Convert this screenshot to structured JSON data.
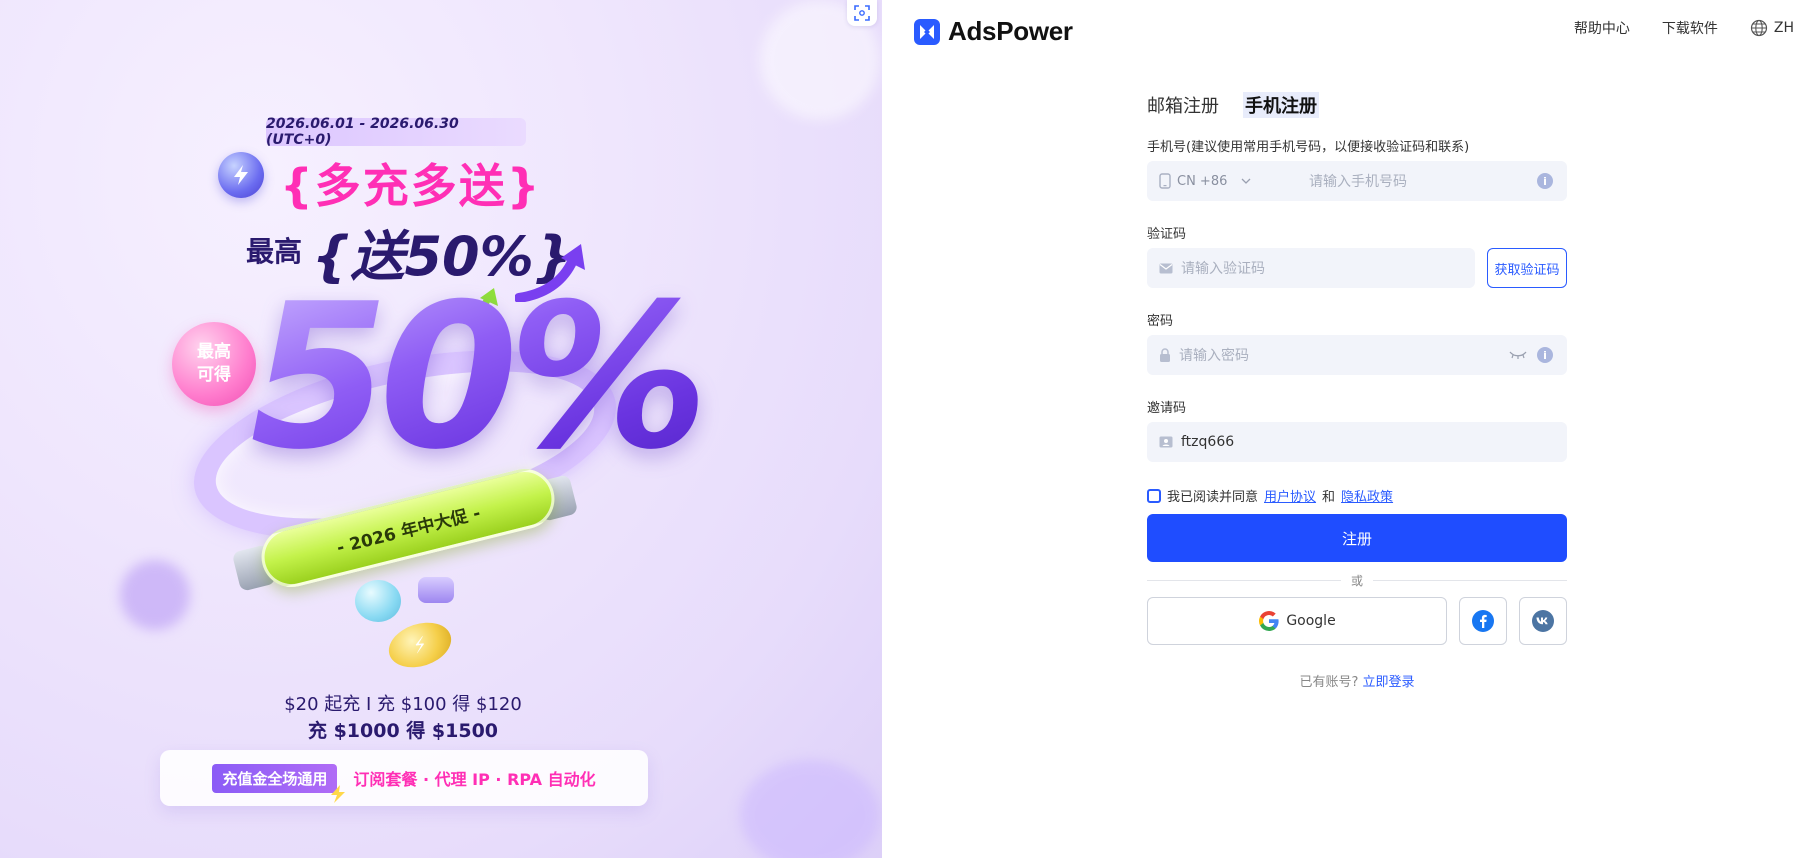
{
  "promo": {
    "date_range": "2026.06.01 - 2026.06.30 (UTC+0)",
    "headline1": "{多充多送}",
    "headline2_prefix": "最高",
    "headline2": "{送50%}",
    "badge_line1": "最高",
    "badge_line2": "可得",
    "big_percent": "50%",
    "tube_text": "- 2026 年中大促 -",
    "line1": "$20 起充 Ⅰ 充 $100 得 $120",
    "line2": "充 $1000 得 $1500",
    "card_tag": "充值金全场通用",
    "card_text": "订阅套餐 · 代理 IP · RPA 自动化"
  },
  "header": {
    "logo_text": "AdsPower",
    "help": "帮助中心",
    "download": "下载软件",
    "lang": "ZH"
  },
  "form": {
    "tabs": [
      {
        "label": "邮箱注册",
        "active": false
      },
      {
        "label": "手机注册",
        "active": true
      }
    ],
    "phone": {
      "label": "手机号(建议使用常用手机号码，以便接收验证码和联系)",
      "country": "CN +86",
      "placeholder": "请输入手机号码"
    },
    "code": {
      "label": "验证码",
      "placeholder": "请输入验证码",
      "button": "获取验证码"
    },
    "password": {
      "label": "密码",
      "placeholder": "请输入密码"
    },
    "invite": {
      "label": "邀请码",
      "value": "ftzq666"
    },
    "agree": {
      "prefix": "我已阅读并同意",
      "terms": "用户协议",
      "and": "和",
      "privacy": "隐私政策"
    },
    "submit": "注册",
    "or": "或",
    "google": "Google",
    "login_prompt": "已有账号?",
    "login_link": "立即登录"
  },
  "colors": {
    "primary": "#1f4dff",
    "accent_pink": "#ff2fb5",
    "promo_text": "#2a1a6e"
  }
}
